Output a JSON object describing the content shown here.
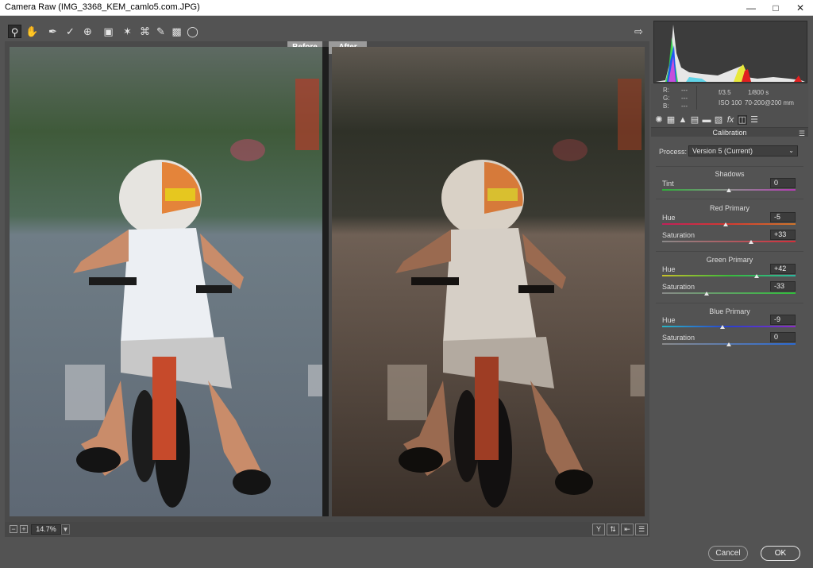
{
  "window": {
    "title": "Camera Raw (IMG_3368_KEM_camlo5.com.JPG)"
  },
  "toolbar": {
    "tools": [
      "zoom-icon",
      "hand-icon",
      "eyedropper-icon",
      "color-sampler-icon",
      "target-adjust-icon",
      "crop-icon",
      "spot-removal-icon",
      "red-eye-icon",
      "brush-icon",
      "graduated-filter-icon",
      "radial-filter-icon"
    ],
    "export_icon": "export-icon"
  },
  "view": {
    "before_label": "Before",
    "after_label": "After"
  },
  "bottom": {
    "zoom_value": "14.7%"
  },
  "info": {
    "r_label": "R:",
    "r_value": "---",
    "g_label": "G:",
    "g_value": "---",
    "b_label": "B:",
    "b_value": "---",
    "aperture": "f/3.5",
    "shutter": "1/800 s",
    "iso": "ISO 100",
    "lens": "70-200@200 mm"
  },
  "panel": {
    "title": "Calibration",
    "process_label": "Process:",
    "process_value": "Version 5 (Current)",
    "shadows": {
      "title": "Shadows",
      "tint_label": "Tint",
      "tint_value": "0"
    },
    "red": {
      "title": "Red Primary",
      "hue_label": "Hue",
      "hue_value": "-5",
      "sat_label": "Saturation",
      "sat_value": "+33"
    },
    "green": {
      "title": "Green Primary",
      "hue_label": "Hue",
      "hue_value": "+42",
      "sat_label": "Saturation",
      "sat_value": "-33"
    },
    "blue": {
      "title": "Blue Primary",
      "hue_label": "Hue",
      "hue_value": "-9",
      "sat_label": "Saturation",
      "sat_value": "0"
    }
  },
  "buttons": {
    "cancel_label": "Cancel",
    "ok_label": "OK"
  },
  "colors": {
    "accent": "#e6e6e6",
    "panel_bg": "#535353",
    "histogram_bg": "#3c3c3c"
  }
}
